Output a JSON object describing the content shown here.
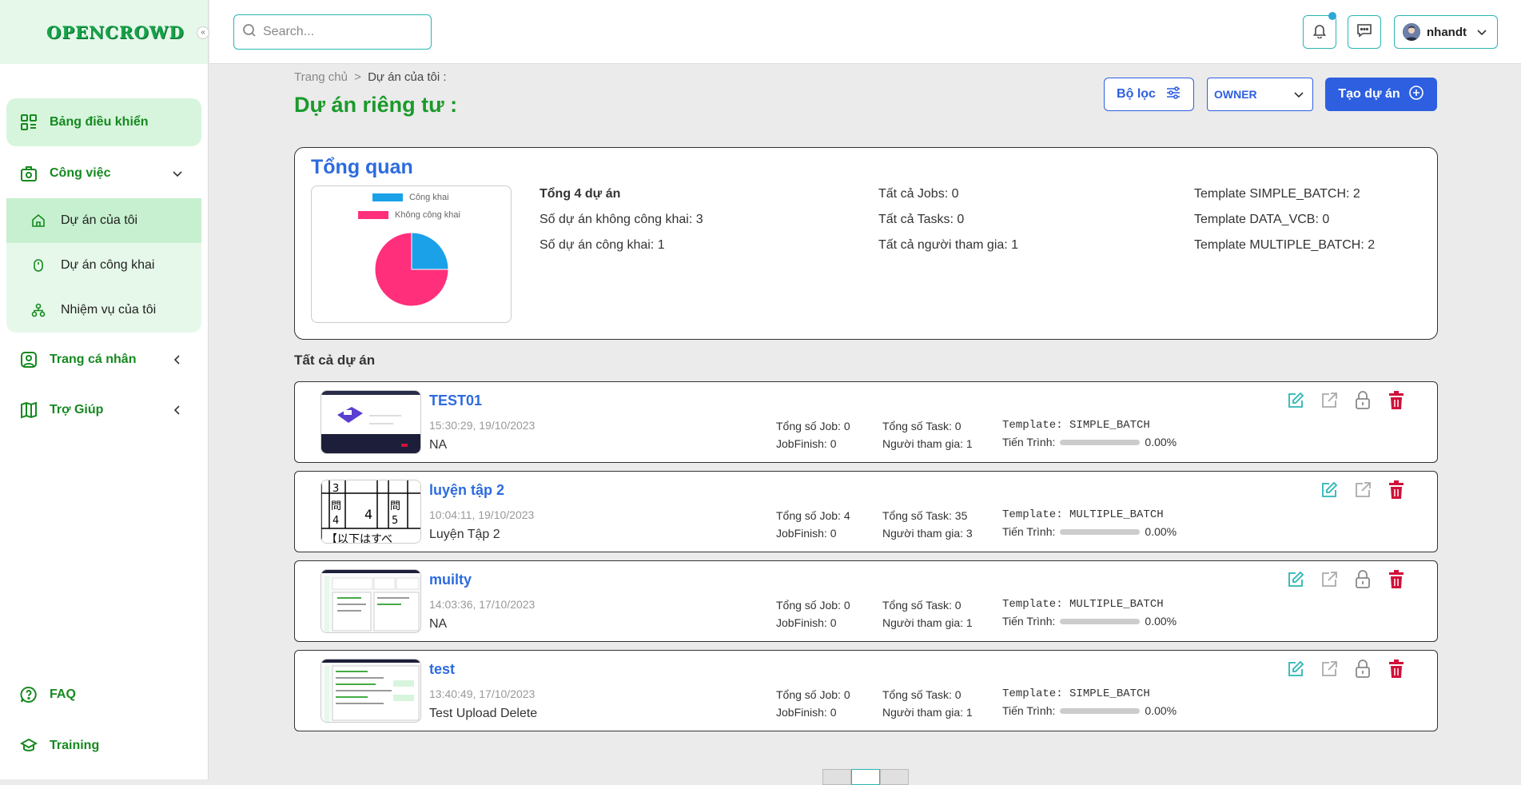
{
  "app": {
    "logo": "OPENCROWD",
    "collapse_symbol": "«"
  },
  "sidebar": {
    "items": [
      {
        "label": "Bảng điều khiển",
        "icon": "dashboard-grid-icon"
      },
      {
        "label": "Công việc",
        "icon": "work-icon"
      },
      {
        "label": "Trang cá nhân",
        "icon": "profile-icon"
      },
      {
        "label": "Trợ Giúp",
        "icon": "book-icon"
      }
    ],
    "subitems": [
      {
        "label": "Dự án của tôi",
        "icon": "home-icon"
      },
      {
        "label": "Dự án công khai",
        "icon": "mouse-icon"
      },
      {
        "label": "Nhiệm vụ của tôi",
        "icon": "hierarchy-icon"
      }
    ],
    "footer": [
      {
        "label": "FAQ",
        "icon": "question-icon"
      },
      {
        "label": "Training",
        "icon": "graduation-icon"
      }
    ]
  },
  "topbar": {
    "search_placeholder": "Search...",
    "username": "nhandt"
  },
  "page": {
    "crumb_home": "Trang chủ",
    "crumb_sep": ">",
    "crumb_current": "Dự án của tôi :",
    "title": "Dự án riêng tư :",
    "filter_label": "Bộ lọc",
    "role_select": "OWNER",
    "create_label": "Tạo dự án"
  },
  "overview": {
    "title": "Tổng quan",
    "legend": [
      {
        "name": "Công khai",
        "color": "#1ba1e8"
      },
      {
        "name": "Không công khai",
        "color": "#ff2f7c"
      }
    ],
    "chart_data": {
      "type": "pie",
      "categories": [
        "Công khai",
        "Không công khai"
      ],
      "values": [
        1,
        3
      ],
      "colors": [
        "#1ba1e8",
        "#ff2f7c"
      ]
    },
    "stats_col1": [
      "Tổng 4 dự án",
      "Số dự án không công khai: 3",
      "Số dự án công khai: 1"
    ],
    "stats_col2": [
      "Tất cả Jobs: 0",
      "Tất cả Tasks: 0",
      "Tất cả người tham gia: 1"
    ],
    "stats_col3": [
      "Template SIMPLE_BATCH: 2",
      "Template DATA_VCB: 0",
      "Template MULTIPLE_BATCH: 2"
    ]
  },
  "projects_title": "Tất cả dự án",
  "projects": [
    {
      "name": "TEST01",
      "date": "15:30:29, 19/10/2023",
      "desc": "NA",
      "total_job": "Tổng số Job: 0",
      "job_finish": "JobFinish: 0",
      "total_task": "Tổng số Task: 0",
      "participants": "Người tham gia: 1",
      "template": "Template: SIMPLE_BATCH",
      "progress_label": "Tiến Trình:",
      "progress": 0,
      "progress_text": "0.00%",
      "locked": true
    },
    {
      "name": "luyện tập 2",
      "date": "10:04:11, 19/10/2023",
      "desc": "Luyện Tập 2",
      "total_job": "Tổng số Job: 4",
      "job_finish": "JobFinish: 0",
      "total_task": "Tổng số Task: 35",
      "participants": "Người tham gia: 3",
      "template": "Template: MULTIPLE_BATCH",
      "progress_label": "Tiến Trình:",
      "progress": 0,
      "progress_text": "0.00%",
      "locked": false
    },
    {
      "name": "muilty",
      "date": "14:03:36, 17/10/2023",
      "desc": "NA",
      "total_job": "Tổng số Job: 0",
      "job_finish": "JobFinish: 0",
      "total_task": "Tổng số Task: 0",
      "participants": "Người tham gia: 1",
      "template": "Template: MULTIPLE_BATCH",
      "progress_label": "Tiến Trình:",
      "progress": 0,
      "progress_text": "0.00%",
      "locked": true
    },
    {
      "name": "test",
      "date": "13:40:49, 17/10/2023",
      "desc": "Test Upload Delete",
      "total_job": "Tổng số Job: 0",
      "job_finish": "JobFinish: 0",
      "total_task": "Tổng số Task: 0",
      "participants": "Người tham gia: 1",
      "template": "Template: SIMPLE_BATCH",
      "progress_label": "Tiến Trình:",
      "progress": 0,
      "progress_text": "0.00%",
      "locked": true
    }
  ],
  "thumb2_text": {
    "a": "3",
    "b": "問",
    "c": "4",
    "d": "4",
    "e": "問",
    "f": "5",
    "g": "【以下はすべ"
  },
  "colors": {
    "brand_green": "#1a9a2a",
    "primary_blue": "#2d5fe0",
    "teal": "#2bb5b5",
    "danger": "#d0103a"
  }
}
